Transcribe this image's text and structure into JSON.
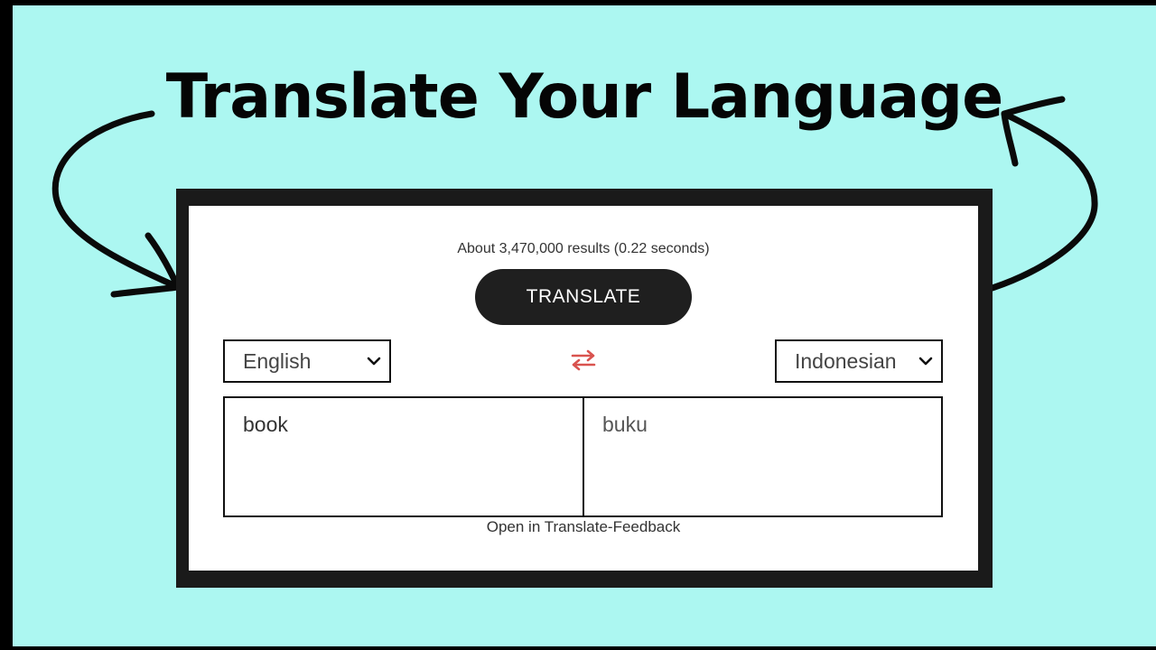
{
  "headline": "Translate Your Language",
  "translator": {
    "results_text": "About 3,470,000 results (0.22 seconds)",
    "translate_button": "TRANSLATE",
    "source_language": "English",
    "target_language": "Indonesian",
    "source_text": "book",
    "target_text": "buku",
    "footer_link": "Open in Translate-Feedback"
  },
  "icons": {
    "swap": "swap-arrows-icon",
    "dropdown": "chevron-down-icon"
  },
  "colors": {
    "background": "#acf7f1",
    "swap_icon": "#d9534f",
    "button": "#1f1f1f"
  }
}
